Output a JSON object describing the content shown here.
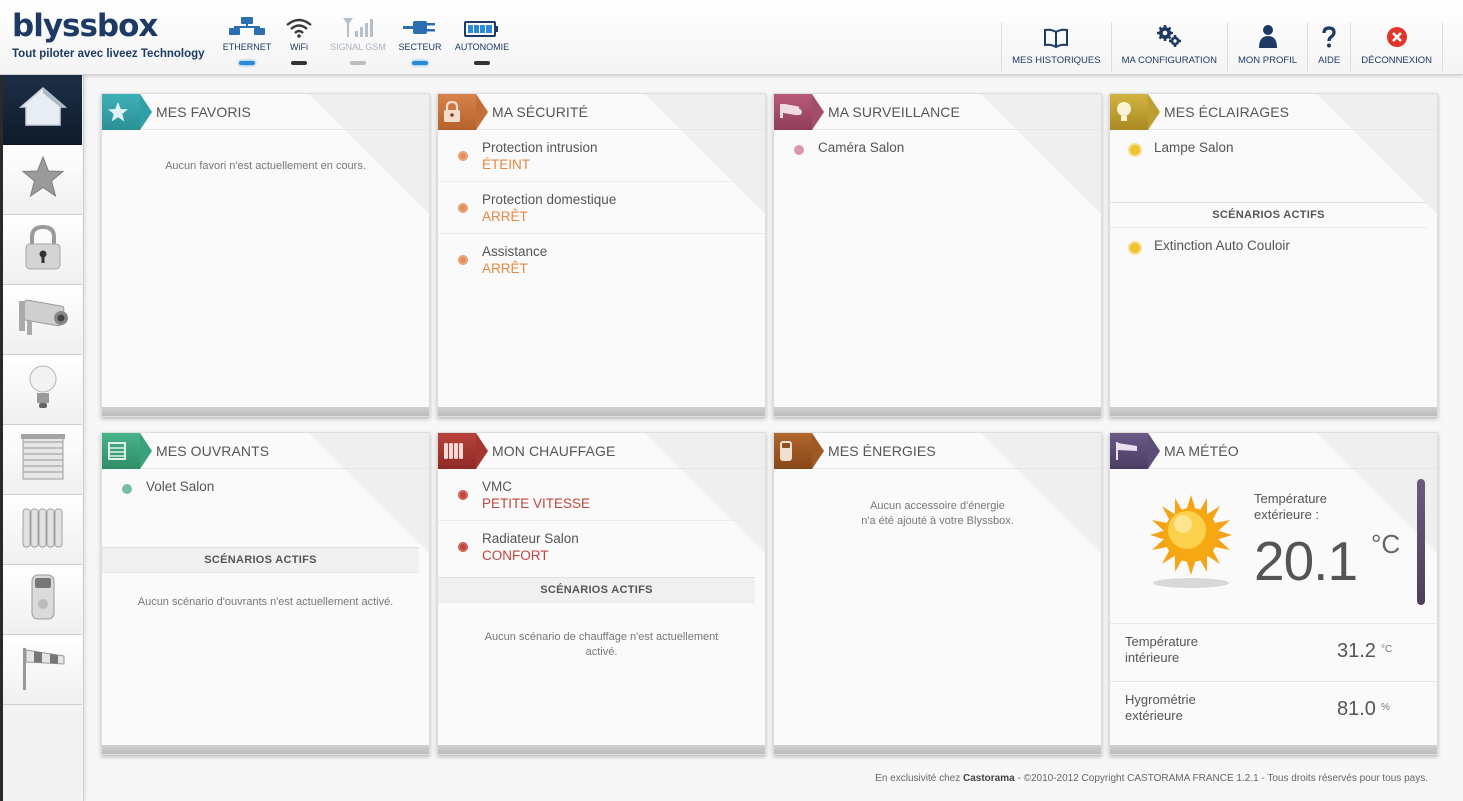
{
  "header": {
    "logo_word": "blyssbox",
    "logo_tagline": "Tout piloter avec liveez Technology",
    "status": [
      {
        "label": "ETHERNET",
        "icon": "ethernet-icon",
        "state": "on"
      },
      {
        "label": "WiFi",
        "icon": "wifi-icon",
        "state": "neutral"
      },
      {
        "label": "SIGNAL GSM",
        "icon": "gsm-signal-icon",
        "state": "off"
      },
      {
        "label": "SECTEUR",
        "icon": "power-plug-icon",
        "state": "on"
      },
      {
        "label": "AUTONOMIE",
        "icon": "battery-icon",
        "state": "neutral"
      }
    ],
    "nav": [
      {
        "label": "MES HISTORIQUES",
        "icon": "book-icon"
      },
      {
        "label": "MA CONFIGURATION",
        "icon": "gears-icon"
      },
      {
        "label": "MON PROFIL",
        "icon": "user-icon"
      },
      {
        "label": "AIDE",
        "icon": "question-icon"
      },
      {
        "label": "DÉCONNEXION",
        "icon": "logout-icon"
      }
    ]
  },
  "sidebar": [
    {
      "name": "home",
      "icon": "home-icon",
      "active": true
    },
    {
      "name": "favorites",
      "icon": "star-icon"
    },
    {
      "name": "security",
      "icon": "padlock-icon"
    },
    {
      "name": "surveillance",
      "icon": "camera-icon"
    },
    {
      "name": "lighting",
      "icon": "bulb-icon"
    },
    {
      "name": "openings",
      "icon": "shutter-icon"
    },
    {
      "name": "heating",
      "icon": "radiator-icon"
    },
    {
      "name": "energy",
      "icon": "energy-icon"
    },
    {
      "name": "weather",
      "icon": "windsock-icon"
    }
  ],
  "panels": {
    "favoris": {
      "title": "MES FAVORIS",
      "empty": "Aucun favori n'est actuellement en cours."
    },
    "securite": {
      "title": "MA SÉCURITÉ",
      "items": [
        {
          "name": "Protection intrusion",
          "state": "ÉTEINT"
        },
        {
          "name": "Protection domestique",
          "state": "ARRÊT"
        },
        {
          "name": "Assistance",
          "state": "ARRÊT"
        }
      ]
    },
    "surveillance": {
      "title": "MA SURVEILLANCE",
      "items": [
        "Caméra Salon"
      ]
    },
    "eclairages": {
      "title": "MES ÉCLAIRAGES",
      "items": [
        "Lampe Salon"
      ],
      "scenarios_title": "SCÉNARIOS ACTIFS",
      "scenarios": [
        "Extinction Auto Couloir"
      ]
    },
    "ouvrants": {
      "title": "MES OUVRANTS",
      "items": [
        "Volet Salon"
      ],
      "scenarios_title": "SCÉNARIOS ACTIFS",
      "scenarios_empty": "Aucun scénario d'ouvrants n'est actuellement activé."
    },
    "chauffage": {
      "title": "MON CHAUFFAGE",
      "items": [
        {
          "name": "VMC",
          "state": "PETITE VITESSE"
        },
        {
          "name": "Radiateur Salon",
          "state": "CONFORT"
        }
      ],
      "scenarios_title": "SCÉNARIOS ACTIFS",
      "scenarios_empty_1": "Aucun scénario de chauffage n'est actuellement",
      "scenarios_empty_2": "activé."
    },
    "energies": {
      "title": "MES ÉNERGIES",
      "empty_1": "Aucun accessoire d'énergie",
      "empty_2": "n'a été ajouté à votre Blyssbox."
    },
    "meteo": {
      "title": "MA MÉTÉO",
      "ext_label_1": "Température",
      "ext_label_2": "extérieure :",
      "ext_temp": "20.1",
      "ext_unit": "°C",
      "rows": [
        {
          "label_1": "Température",
          "label_2": "intérieure",
          "value": "31.2",
          "unit": "°C"
        },
        {
          "label_1": "Hygrométrie",
          "label_2": "extérieure",
          "value": "81.0",
          "unit": "%"
        }
      ]
    }
  },
  "footer": {
    "prefix": "En exclusivité chez ",
    "brand": "Castorama",
    "suffix": " - ©2010-2012 Copyright CASTORAMA FRANCE 1.2.1 - Tous droits réservés pour tous pays."
  },
  "colors": {
    "brand_navy": "#1c3a63",
    "active_blue": "#2b8bd6",
    "state_orange": "#e58840",
    "state_red": "#c0463f"
  }
}
